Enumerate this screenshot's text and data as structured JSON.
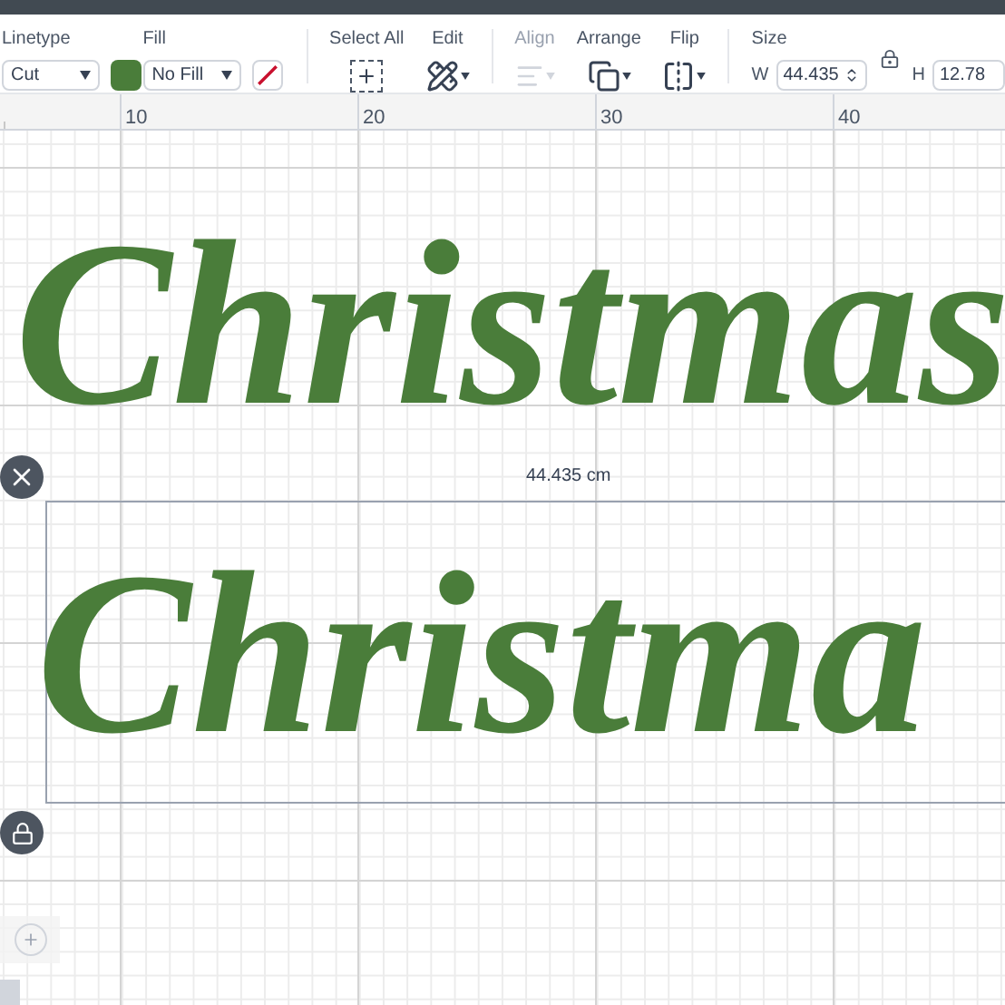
{
  "toolbar": {
    "linetype": {
      "label": "Linetype",
      "value": "Cut"
    },
    "fill": {
      "label": "Fill",
      "value": "No Fill"
    },
    "tools": [
      {
        "label": "Select All",
        "kind": "select",
        "disabled": false
      },
      {
        "label": "Edit",
        "kind": "edit",
        "disabled": false
      },
      {
        "label": "Align",
        "kind": "align",
        "disabled": true
      },
      {
        "label": "Arrange",
        "kind": "arrange",
        "disabled": false
      },
      {
        "label": "Flip",
        "kind": "flip",
        "disabled": false
      }
    ],
    "size": {
      "label": "Size",
      "w_label": "W",
      "w_value": "44.435",
      "h_label": "H",
      "h_value": "12.78"
    }
  },
  "ruler": [
    "10",
    "20",
    "30",
    "40"
  ],
  "canvas": {
    "dimension": "44.435 cm",
    "objects": [
      {
        "text": "Christmas",
        "selected": false
      },
      {
        "text": "Christma",
        "selected": true
      }
    ]
  }
}
